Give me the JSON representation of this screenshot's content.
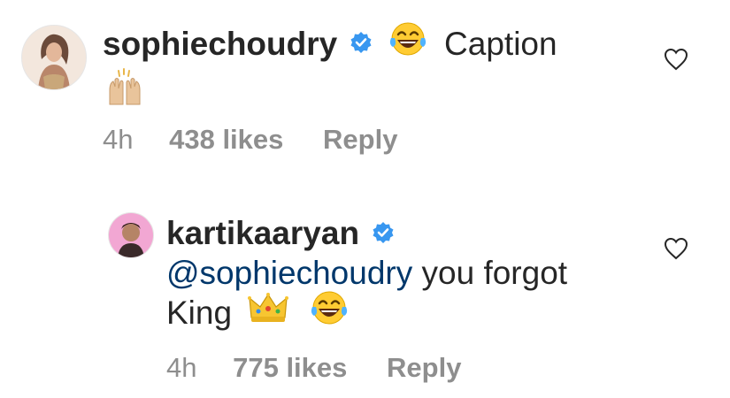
{
  "comments": [
    {
      "username": "sophiechoudry",
      "verified": true,
      "text": "Caption",
      "emoji_line_1": "laughing-tears",
      "emoji_line_2": "raising-hands",
      "time": "4h",
      "likes": "438 likes",
      "reply": "Reply"
    },
    {
      "username": "kartikaaryan",
      "verified": true,
      "mention": "@sophiechoudry",
      "text_after_mention": "you forgot",
      "line2_text": "King",
      "emoji_1": "crown",
      "emoji_2": "laughing-tears",
      "time": "4h",
      "likes": "775 likes",
      "reply": "Reply"
    }
  ],
  "colors": {
    "verified_blue": "#3897f0",
    "meta_gray": "#8e8e8e",
    "mention_blue": "#00376b",
    "text": "#262626"
  }
}
